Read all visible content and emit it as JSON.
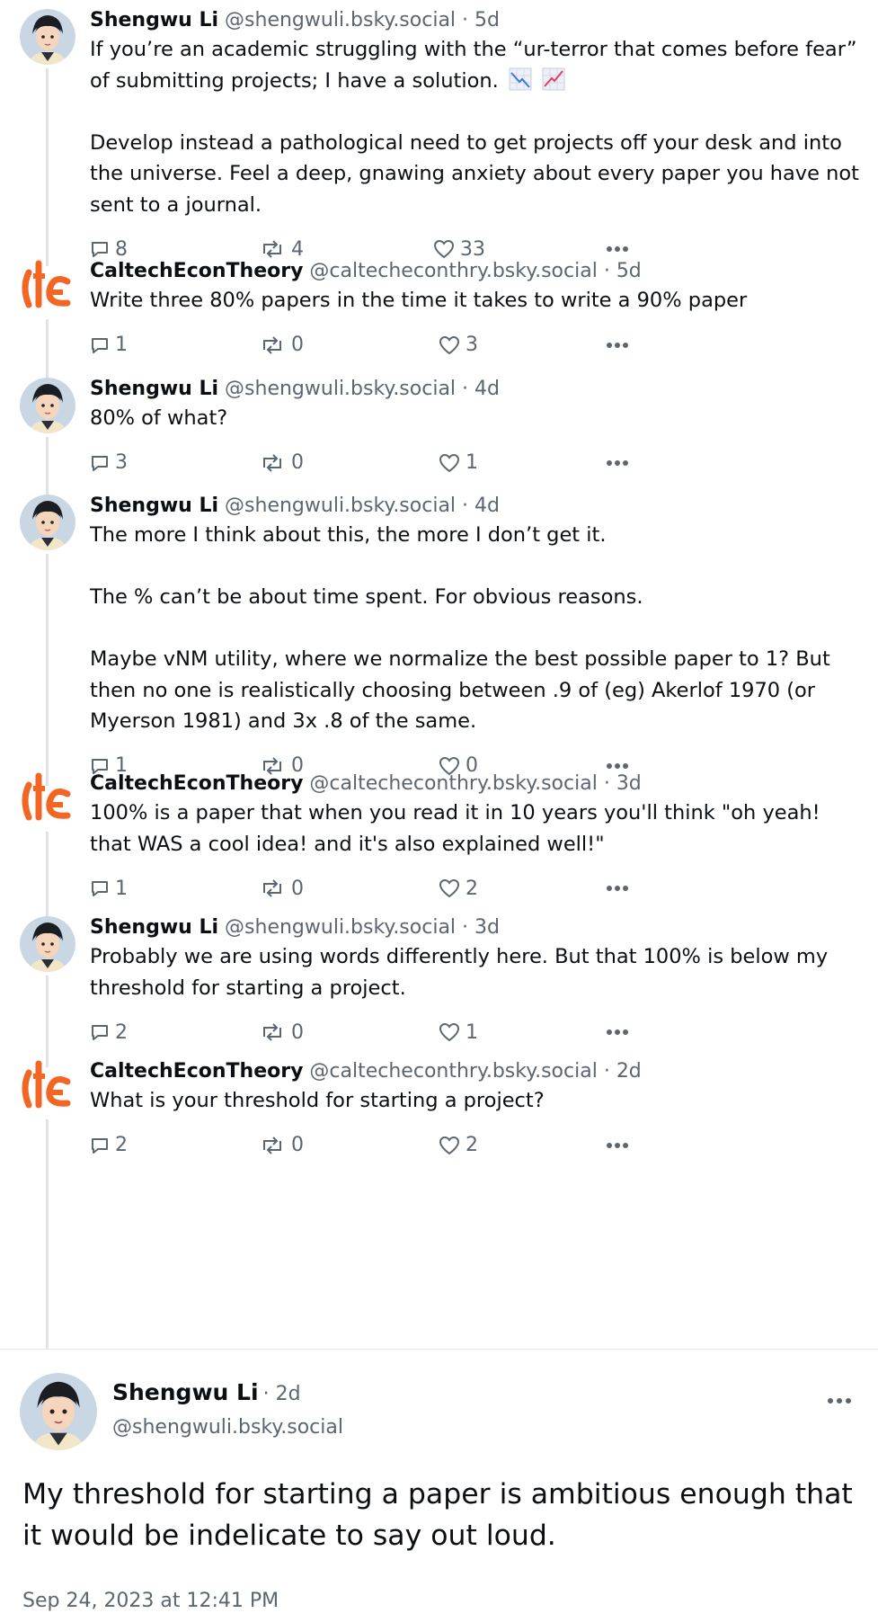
{
  "posts": [
    {
      "author": "Shengwu Li",
      "handle": "@shengwuli.bsky.social",
      "time": "· 5d",
      "avatar": "shengwu",
      "text": [
        "If you’re an academic struggling with the “ur-terror that comes before fear” of submitting projects; I have a solution.",
        "Develop instead a pathological need to get projects off your desk and into the universe. Feel a deep, gnawing anxiety about every paper you have not sent to a journal."
      ],
      "replies": "8",
      "reposts": "4",
      "likes": "33"
    },
    {
      "author": "CaltechEconTheory",
      "handle": "@caltecheconthry.bsky.social",
      "time": "· 5d",
      "avatar": "caltech",
      "text": [
        "Write three 80% papers in the time it takes to write a 90% paper"
      ],
      "replies": "1",
      "reposts": "0",
      "likes": "3"
    },
    {
      "author": "Shengwu Li",
      "handle": "@shengwuli.bsky.social",
      "time": "· 4d",
      "avatar": "shengwu",
      "text": [
        "80% of what?"
      ],
      "replies": "3",
      "reposts": "0",
      "likes": "1"
    },
    {
      "author": "Shengwu Li",
      "handle": "@shengwuli.bsky.social",
      "time": "· 4d",
      "avatar": "shengwu",
      "text": [
        "The more I think about this, the more I don’t get it.",
        "The % can’t be about time spent. For obvious reasons.",
        "Maybe vNM utility, where we normalize the best possible paper to 1? But then no one is realistically choosing between .9 of (eg) Akerlof 1970 (or Myerson 1981) and 3x .8 of the same."
      ],
      "replies": "1",
      "reposts": "0",
      "likes": "0"
    },
    {
      "author": "CaltechEconTheory",
      "handle": "@caltecheconthry.bsky.social",
      "time": "· 3d",
      "avatar": "caltech",
      "text": [
        "100% is a paper that when you read it in 10 years you'll think \"oh yeah! that WAS a cool idea! and it's also explained well!\""
      ],
      "replies": "1",
      "reposts": "0",
      "likes": "2"
    },
    {
      "author": "Shengwu Li",
      "handle": "@shengwuli.bsky.social",
      "time": "· 3d",
      "avatar": "shengwu",
      "text": [
        "Probably we are using words differently here. But that 100% is below my threshold for starting a project."
      ],
      "replies": "2",
      "reposts": "0",
      "likes": "1"
    },
    {
      "author": "CaltechEconTheory",
      "handle": "@caltecheconthry.bsky.social",
      "time": "· 2d",
      "avatar": "caltech",
      "text": [
        "What is your threshold for starting a project?"
      ],
      "replies": "2",
      "reposts": "0",
      "likes": "2"
    }
  ],
  "emoji": [
    "chart-decreasing",
    "chart-increasing"
  ],
  "focused": {
    "author": "Shengwu Li",
    "time": "· 2d",
    "handle": "@shengwuli.bsky.social",
    "text": "My threshold for starting a paper is ambitious enough that it would be indelicate to say out loud.",
    "date": "Sep 24, 2023 at 12:41 PM"
  },
  "colors": {
    "caltech_orange": "#f26522",
    "muted": "#5b6671",
    "thread_line": "#dfe3e8"
  }
}
